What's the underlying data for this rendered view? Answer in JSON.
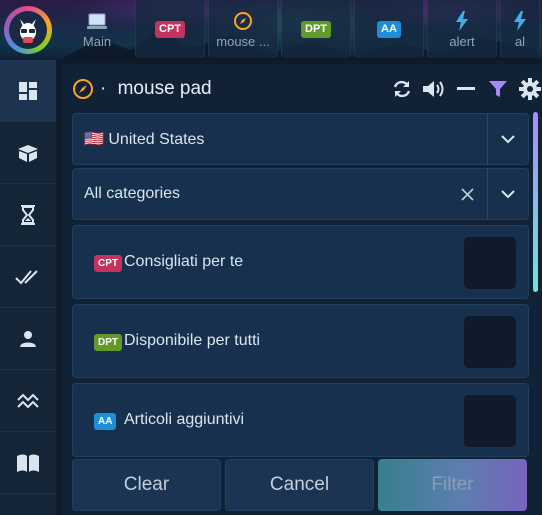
{
  "topbar": {
    "tabs": [
      {
        "label": "Main",
        "icon": "laptop-icon"
      },
      {
        "badge": "CPT",
        "badge_color": "#c2335e",
        "label": ""
      },
      {
        "label": "mouse ...",
        "icon": "compass-icon"
      },
      {
        "badge": "DPT",
        "badge_color": "#5f9a2b",
        "label": ""
      },
      {
        "badge": "AA",
        "badge_color": "#1e8fd6",
        "label": ""
      },
      {
        "label": "alert",
        "icon": "bolt-icon"
      },
      {
        "label": "al",
        "icon": "bolt-icon"
      }
    ]
  },
  "sidebar": {
    "items": [
      {
        "icon": "dashboard-icon",
        "active": true
      },
      {
        "icon": "box-icon"
      },
      {
        "icon": "hourglass-icon"
      },
      {
        "icon": "double-check-icon"
      },
      {
        "icon": "user-icon"
      },
      {
        "icon": "trend-icon"
      },
      {
        "icon": "book-icon"
      }
    ]
  },
  "panel": {
    "title_prefix": "·",
    "title": "mouse pad",
    "country_select": {
      "flag": "🇺🇸",
      "value": "United States"
    },
    "category_select": {
      "value": "All categories",
      "clear": "X"
    },
    "options": [
      {
        "badge": "CPT",
        "badge_color": "#c2335e",
        "label": "Consigliati per te"
      },
      {
        "badge": "DPT",
        "badge_color": "#5f9a2b",
        "label": "Disponibile per tutti"
      },
      {
        "badge": "AA",
        "badge_color": "#1e8fd6",
        "label": "Articoli aggiuntivi"
      }
    ],
    "footer": {
      "clear_label": "Clear",
      "cancel_label": "Cancel",
      "filter_label": "Filter"
    }
  },
  "colors": {
    "accent_orange": "#f5a623",
    "accent_purple": "#a78bfa",
    "panel_bg": "#112236"
  }
}
